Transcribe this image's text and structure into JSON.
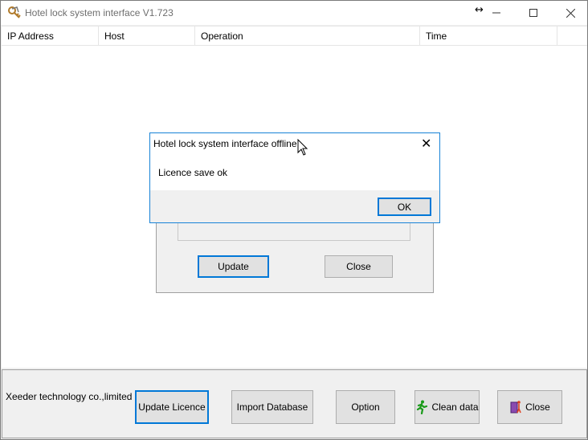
{
  "window": {
    "title": "Hotel lock system interface V1.723",
    "icons": {
      "app": "keys-icon",
      "min": "minimize-icon",
      "max": "maximize-icon",
      "close": "close-icon",
      "resize": "resize-horizontal-icon"
    }
  },
  "table": {
    "columns": [
      "IP Address",
      "Host",
      "Operation",
      "Time"
    ]
  },
  "background_dialog": {
    "update_label": "Update",
    "close_label": "Close"
  },
  "message_box": {
    "title": "Hotel lock system interface offline",
    "message": "Licence save ok",
    "ok_label": "OK"
  },
  "footer": {
    "company": "Xeeder technology co.,limited",
    "buttons": [
      {
        "label": "Update Licence",
        "icon": ""
      },
      {
        "label": "Import Database",
        "icon": ""
      },
      {
        "label": "Option",
        "icon": ""
      },
      {
        "label": "Clean data",
        "icon": "running-man-icon"
      },
      {
        "label": "Close",
        "icon": "exit-door-icon"
      }
    ]
  },
  "colors": {
    "accent": "#0078d7",
    "button_face": "#e1e1e1",
    "panel": "#f0f0f0"
  }
}
